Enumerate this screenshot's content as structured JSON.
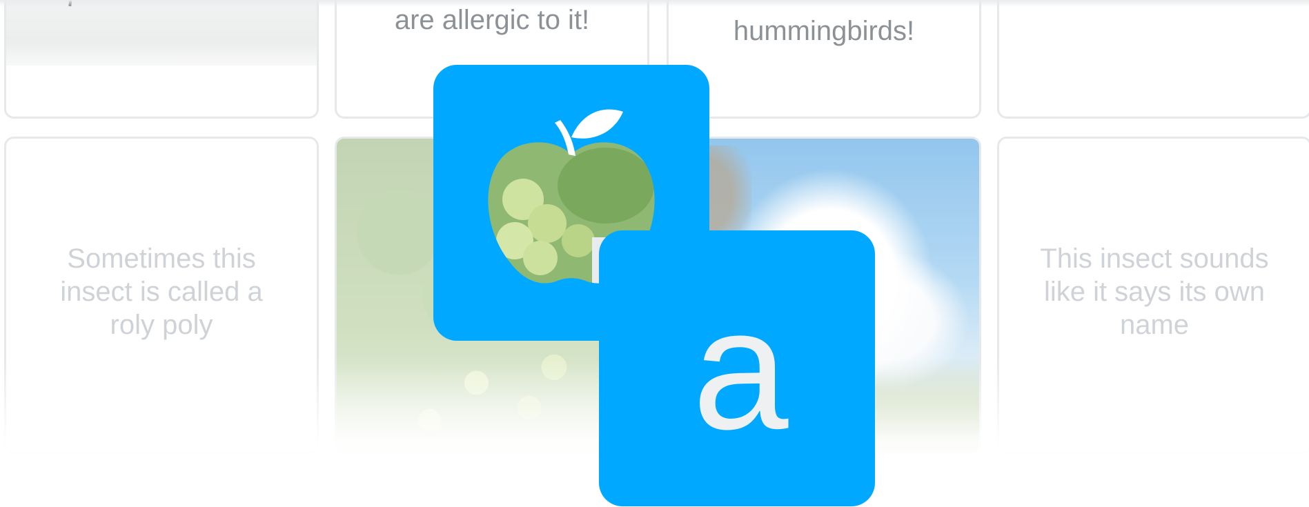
{
  "cards": {
    "top_row": {
      "card_2_text": "are allergic to it!",
      "card_3_text": "hummingbirds!"
    },
    "bottom_row": {
      "card_1_text": [
        "Sometimes this",
        "insect is called a",
        "roly poly"
      ],
      "card_4_text": [
        "This insect sounds",
        "like it says its own",
        "name"
      ]
    }
  },
  "logo": {
    "letter": "a",
    "icon": "apple-icon",
    "color": "#00a9ff"
  }
}
